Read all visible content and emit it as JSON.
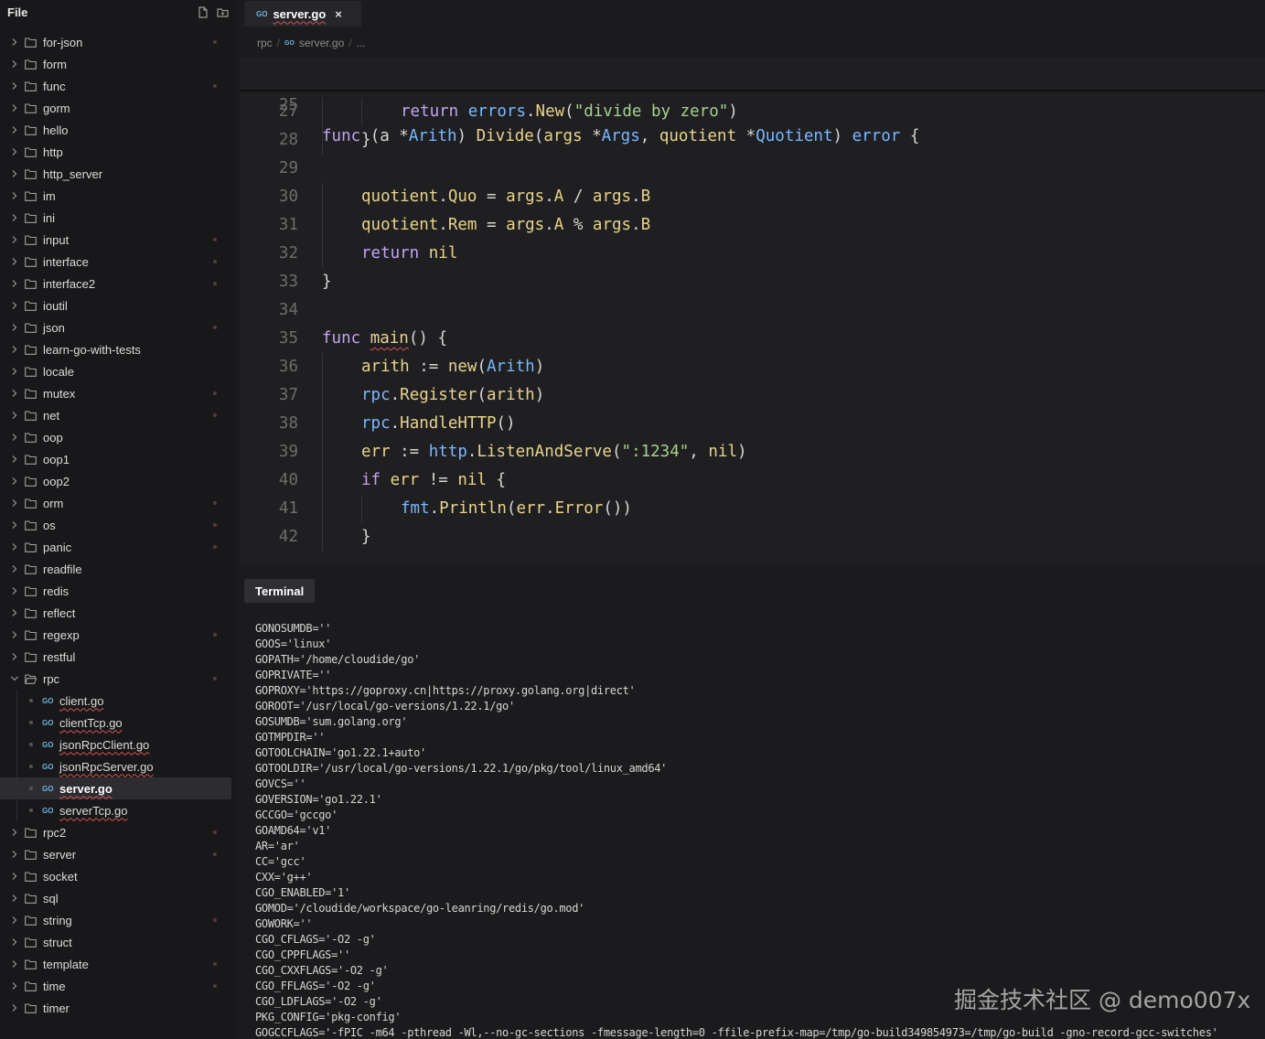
{
  "sidebar": {
    "title": "File",
    "new_file_icon": "new-file-icon",
    "new_folder_icon": "new-folder-icon",
    "items": [
      {
        "type": "folder",
        "label": "for-json",
        "expanded": false,
        "modified": true
      },
      {
        "type": "folder",
        "label": "form",
        "expanded": false,
        "modified": false
      },
      {
        "type": "folder",
        "label": "func",
        "expanded": false,
        "modified": true
      },
      {
        "type": "folder",
        "label": "gorm",
        "expanded": false,
        "modified": false
      },
      {
        "type": "folder",
        "label": "hello",
        "expanded": false,
        "modified": false
      },
      {
        "type": "folder",
        "label": "http",
        "expanded": false,
        "modified": false
      },
      {
        "type": "folder",
        "label": "http_server",
        "expanded": false,
        "modified": false
      },
      {
        "type": "folder",
        "label": "im",
        "expanded": false,
        "modified": false
      },
      {
        "type": "folder",
        "label": "ini",
        "expanded": false,
        "modified": false
      },
      {
        "type": "folder",
        "label": "input",
        "expanded": false,
        "modified": true
      },
      {
        "type": "folder",
        "label": "interface",
        "expanded": false,
        "modified": true
      },
      {
        "type": "folder",
        "label": "interface2",
        "expanded": false,
        "modified": true
      },
      {
        "type": "folder",
        "label": "ioutil",
        "expanded": false,
        "modified": false
      },
      {
        "type": "folder",
        "label": "json",
        "expanded": false,
        "modified": true
      },
      {
        "type": "folder",
        "label": "learn-go-with-tests",
        "expanded": false,
        "modified": false
      },
      {
        "type": "folder",
        "label": "locale",
        "expanded": false,
        "modified": false
      },
      {
        "type": "folder",
        "label": "mutex",
        "expanded": false,
        "modified": true
      },
      {
        "type": "folder",
        "label": "net",
        "expanded": false,
        "modified": true
      },
      {
        "type": "folder",
        "label": "oop",
        "expanded": false,
        "modified": false
      },
      {
        "type": "folder",
        "label": "oop1",
        "expanded": false,
        "modified": false
      },
      {
        "type": "folder",
        "label": "oop2",
        "expanded": false,
        "modified": false
      },
      {
        "type": "folder",
        "label": "orm",
        "expanded": false,
        "modified": true
      },
      {
        "type": "folder",
        "label": "os",
        "expanded": false,
        "modified": true
      },
      {
        "type": "folder",
        "label": "panic",
        "expanded": false,
        "modified": true
      },
      {
        "type": "folder",
        "label": "readfile",
        "expanded": false,
        "modified": false
      },
      {
        "type": "folder",
        "label": "redis",
        "expanded": false,
        "modified": false
      },
      {
        "type": "folder",
        "label": "reflect",
        "expanded": false,
        "modified": false
      },
      {
        "type": "folder",
        "label": "regexp",
        "expanded": false,
        "modified": true
      },
      {
        "type": "folder",
        "label": "restful",
        "expanded": false,
        "modified": false
      },
      {
        "type": "folder",
        "label": "rpc",
        "expanded": true,
        "modified": true
      },
      {
        "type": "file",
        "label": "client.go",
        "icon": "go",
        "active": false
      },
      {
        "type": "file",
        "label": "clientTcp.go",
        "icon": "go",
        "active": false
      },
      {
        "type": "file",
        "label": "jsonRpcClient.go",
        "icon": "go",
        "active": false
      },
      {
        "type": "file",
        "label": "jsonRpcServer.go",
        "icon": "go",
        "active": false
      },
      {
        "type": "file",
        "label": "server.go",
        "icon": "go",
        "active": true
      },
      {
        "type": "file",
        "label": "serverTcp.go",
        "icon": "go",
        "active": false
      },
      {
        "type": "folder",
        "label": "rpc2",
        "expanded": false,
        "modified": true
      },
      {
        "type": "folder",
        "label": "server",
        "expanded": false,
        "modified": true
      },
      {
        "type": "folder",
        "label": "socket",
        "expanded": false,
        "modified": false
      },
      {
        "type": "folder",
        "label": "sql",
        "expanded": false,
        "modified": false
      },
      {
        "type": "folder",
        "label": "string",
        "expanded": false,
        "modified": true
      },
      {
        "type": "folder",
        "label": "struct",
        "expanded": false,
        "modified": false
      },
      {
        "type": "folder",
        "label": "template",
        "expanded": false,
        "modified": true
      },
      {
        "type": "folder",
        "label": "time",
        "expanded": false,
        "modified": true
      },
      {
        "type": "folder",
        "label": "timer",
        "expanded": false,
        "modified": false
      }
    ]
  },
  "editor": {
    "tab": {
      "label": "server.go",
      "icon": "go",
      "close": "×"
    },
    "breadcrumb": {
      "folder": "rpc",
      "file": "server.go",
      "more": "..."
    },
    "sticky": {
      "line": "25",
      "tokens": [
        [
          "kw",
          "func "
        ],
        [
          "pun",
          "(a *"
        ],
        [
          "ty",
          "Arith"
        ],
        [
          "pun",
          ") "
        ],
        [
          "fn",
          "Divide"
        ],
        [
          "pun",
          "("
        ],
        [
          "var",
          "args"
        ],
        [
          "pun",
          " *"
        ],
        [
          "ty",
          "Args"
        ],
        [
          "pun",
          ", "
        ],
        [
          "var",
          "quotient"
        ],
        [
          "pun",
          " *"
        ],
        [
          "ty",
          "Quotient"
        ],
        [
          "pun",
          ") "
        ],
        [
          "ty",
          "error"
        ],
        [
          "pun",
          " {"
        ]
      ]
    },
    "lines": [
      {
        "n": "27",
        "indent": 2,
        "tokens": [
          [
            "kw",
            "return "
          ],
          [
            "pkg",
            "errors"
          ],
          [
            "pun",
            "."
          ],
          [
            "fn",
            "New"
          ],
          [
            "pun",
            "("
          ],
          [
            "str",
            "\"divide by zero\""
          ],
          [
            "pun",
            ")"
          ]
        ]
      },
      {
        "n": "28",
        "indent": 1,
        "tokens": [
          [
            "pun",
            "}"
          ]
        ]
      },
      {
        "n": "29",
        "indent": 0,
        "tokens": []
      },
      {
        "n": "30",
        "indent": 1,
        "tokens": [
          [
            "var",
            "quotient"
          ],
          [
            "pun",
            "."
          ],
          [
            "var",
            "Quo"
          ],
          [
            "pun",
            " = "
          ],
          [
            "var",
            "args"
          ],
          [
            "pun",
            "."
          ],
          [
            "var",
            "A"
          ],
          [
            "pun",
            " / "
          ],
          [
            "var",
            "args"
          ],
          [
            "pun",
            "."
          ],
          [
            "var",
            "B"
          ]
        ]
      },
      {
        "n": "31",
        "indent": 1,
        "tokens": [
          [
            "var",
            "quotient"
          ],
          [
            "pun",
            "."
          ],
          [
            "var",
            "Rem"
          ],
          [
            "pun",
            " = "
          ],
          [
            "var",
            "args"
          ],
          [
            "pun",
            "."
          ],
          [
            "var",
            "A"
          ],
          [
            "pun",
            " % "
          ],
          [
            "var",
            "args"
          ],
          [
            "pun",
            "."
          ],
          [
            "var",
            "B"
          ]
        ]
      },
      {
        "n": "32",
        "indent": 1,
        "tokens": [
          [
            "kw",
            "return "
          ],
          [
            "nil",
            "nil"
          ]
        ]
      },
      {
        "n": "33",
        "indent": 0,
        "tokens": [
          [
            "pun",
            "}"
          ]
        ]
      },
      {
        "n": "34",
        "indent": 0,
        "tokens": []
      },
      {
        "n": "35",
        "indent": 0,
        "tokens": [
          [
            "kw",
            "func "
          ],
          [
            "fnw",
            "main"
          ],
          [
            "pun",
            "() {"
          ]
        ]
      },
      {
        "n": "36",
        "indent": 1,
        "tokens": [
          [
            "var",
            "arith"
          ],
          [
            "pun",
            " := "
          ],
          [
            "fn",
            "new"
          ],
          [
            "pun",
            "("
          ],
          [
            "ty",
            "Arith"
          ],
          [
            "pun",
            ")"
          ]
        ]
      },
      {
        "n": "37",
        "indent": 1,
        "tokens": [
          [
            "pkg",
            "rpc"
          ],
          [
            "pun",
            "."
          ],
          [
            "fn",
            "Register"
          ],
          [
            "pun",
            "("
          ],
          [
            "var",
            "arith"
          ],
          [
            "pun",
            ")"
          ]
        ]
      },
      {
        "n": "38",
        "indent": 1,
        "tokens": [
          [
            "pkg",
            "rpc"
          ],
          [
            "pun",
            "."
          ],
          [
            "fn",
            "HandleHTTP"
          ],
          [
            "pun",
            "()"
          ]
        ]
      },
      {
        "n": "39",
        "indent": 1,
        "tokens": [
          [
            "var",
            "err"
          ],
          [
            "pun",
            " := "
          ],
          [
            "pkg",
            "http"
          ],
          [
            "pun",
            "."
          ],
          [
            "fn",
            "ListenAndServe"
          ],
          [
            "pun",
            "("
          ],
          [
            "str",
            "\":1234\""
          ],
          [
            "pun",
            ", "
          ],
          [
            "nil",
            "nil"
          ],
          [
            "pun",
            ")"
          ]
        ]
      },
      {
        "n": "40",
        "indent": 1,
        "tokens": [
          [
            "kw",
            "if "
          ],
          [
            "var",
            "err"
          ],
          [
            "pun",
            " != "
          ],
          [
            "nil",
            "nil"
          ],
          [
            "pun",
            " {"
          ]
        ]
      },
      {
        "n": "41",
        "indent": 2,
        "tokens": [
          [
            "pkg",
            "fmt"
          ],
          [
            "pun",
            "."
          ],
          [
            "fn",
            "Println"
          ],
          [
            "pun",
            "("
          ],
          [
            "var",
            "err"
          ],
          [
            "pun",
            "."
          ],
          [
            "fn",
            "Error"
          ],
          [
            "pun",
            "())"
          ]
        ]
      },
      {
        "n": "42",
        "indent": 1,
        "tokens": [
          [
            "pun",
            "}"
          ]
        ]
      }
    ]
  },
  "terminal": {
    "tab_label": "Terminal",
    "lines": [
      "GONOSUMDB=''",
      "GOOS='linux'",
      "GOPATH='/home/cloudide/go'",
      "GOPRIVATE=''",
      "GOPROXY='https://goproxy.cn|https://proxy.golang.org|direct'",
      "GOROOT='/usr/local/go-versions/1.22.1/go'",
      "GOSUMDB='sum.golang.org'",
      "GOTMPDIR=''",
      "GOTOOLCHAIN='go1.22.1+auto'",
      "GOTOOLDIR='/usr/local/go-versions/1.22.1/go/pkg/tool/linux_amd64'",
      "GOVCS=''",
      "GOVERSION='go1.22.1'",
      "GCCGO='gccgo'",
      "GOAMD64='v1'",
      "AR='ar'",
      "CC='gcc'",
      "CXX='g++'",
      "CGO_ENABLED='1'",
      "GOMOD='/cloudide/workspace/go-leanring/redis/go.mod'",
      "GOWORK=''",
      "CGO_CFLAGS='-O2 -g'",
      "CGO_CPPFLAGS=''",
      "CGO_CXXFLAGS='-O2 -g'",
      "CGO_FFLAGS='-O2 -g'",
      "CGO_LDFLAGS='-O2 -g'",
      "PKG_CONFIG='pkg-config'",
      "GOGCCFLAGS='-fPIC -m64 -pthread -Wl,--no-gc-sections -fmessage-length=0 -ffile-prefix-map=/tmp/go-build349854973=/tmp/go-build -gno-record-gcc-switches'"
    ]
  },
  "watermark": "掘金技术社区 @ demo007x"
}
